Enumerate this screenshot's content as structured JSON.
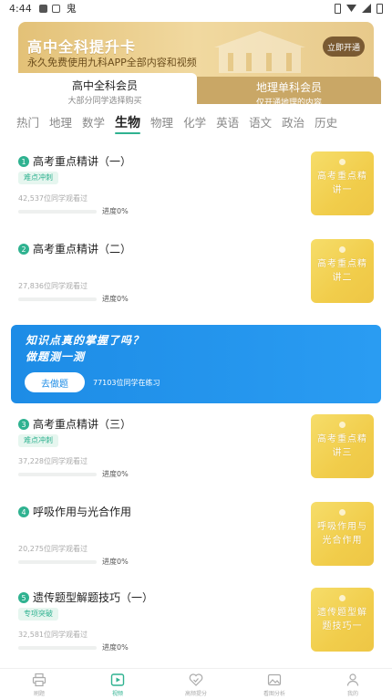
{
  "status_bar": {
    "time": "4:44",
    "app_glyph": "鬼"
  },
  "banner": {
    "title": "高中全科提升卡",
    "subtitle": "永久免费使用九科APP全部内容和视频",
    "button": "立即开通"
  },
  "member_tabs": [
    {
      "title": "高中全科会员",
      "subtitle": "大部分同学选择购买",
      "active": true
    },
    {
      "title": "地理单科会员",
      "subtitle": "仅开通地理的内容",
      "active": false
    }
  ],
  "subjects": [
    "热门",
    "地理",
    "数学",
    "生物",
    "物理",
    "化学",
    "英语",
    "语文",
    "政治",
    "历史"
  ],
  "active_subject": "生物",
  "courses": [
    {
      "index": "1",
      "title": "高考重点精讲（一）",
      "tag": "难点冲刺",
      "views": "42,537位同学观看过",
      "progress_label": "进度0%",
      "progress": 0,
      "thumb_text": "高考重点精讲一"
    },
    {
      "index": "2",
      "title": "高考重点精讲（二）",
      "tag": "",
      "views": "27,836位同学观看过",
      "progress_label": "进度0%",
      "progress": 0,
      "thumb_text": "高考重点精讲二"
    },
    {
      "index": "3",
      "title": "高考重点精讲（三）",
      "tag": "难点冲刺",
      "views": "37,228位同学观看过",
      "progress_label": "进度0%",
      "progress": 0,
      "thumb_text": "高考重点精讲三"
    },
    {
      "index": "4",
      "title": "呼吸作用与光合作用",
      "tag": "",
      "views": "20,275位同学观看过",
      "progress_label": "进度0%",
      "progress": 0,
      "thumb_text": "呼吸作用与光合作用"
    },
    {
      "index": "5",
      "title": "遗传题型解题技巧（一）",
      "tag": "专项突破",
      "views": "32,581位同学观看过",
      "progress_label": "进度0%",
      "progress": 0,
      "thumb_text": "遗传题型解题技巧一"
    }
  ],
  "quiz": {
    "line1": "知识点真的掌握了吗？",
    "line2": "做题测一测",
    "button": "去做题",
    "count": "77103位同学在练习"
  },
  "bottom_nav": [
    {
      "label": "刷题",
      "icon": "printer-icon",
      "active": false
    },
    {
      "label": "视频",
      "icon": "play-video-icon",
      "active": true
    },
    {
      "label": "高频提分",
      "icon": "heart-check-icon",
      "active": false
    },
    {
      "label": "看图分析",
      "icon": "picture-icon",
      "active": false
    },
    {
      "label": "我的",
      "icon": "person-icon",
      "active": false
    }
  ],
  "colors": {
    "accent": "#2fb290",
    "quiz_blue": "#1d8ce6",
    "gold": "#c9a766",
    "thumb_yellow": "#f1cd4b"
  }
}
